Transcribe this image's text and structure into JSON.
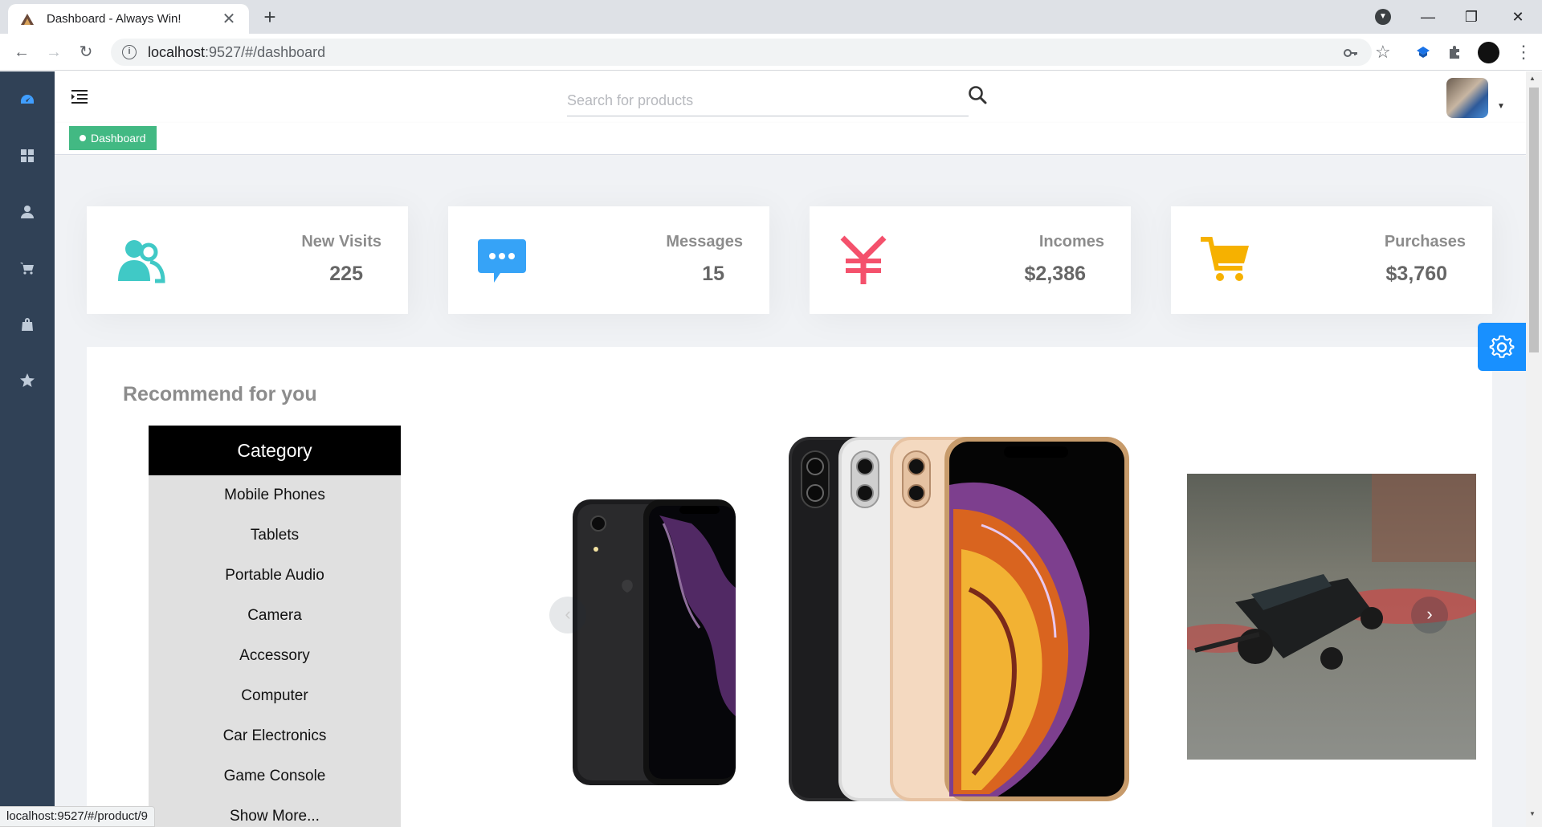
{
  "browser": {
    "tab_title": "Dashboard - Always Win!",
    "url_host": "localhost",
    "url_path": ":9527/#/dashboard",
    "status_url": "localhost:9527/#/product/9"
  },
  "navbar": {
    "search_placeholder": "Search for products"
  },
  "tags": [
    {
      "label": "Dashboard",
      "active": true
    }
  ],
  "sidebar": {
    "items": [
      {
        "icon": "dashboard-icon"
      },
      {
        "icon": "component-icon"
      },
      {
        "icon": "user-icon"
      },
      {
        "icon": "cart-icon"
      },
      {
        "icon": "shopping-bag-icon"
      },
      {
        "icon": "star-icon"
      }
    ]
  },
  "cards": [
    {
      "label": "New Visits",
      "value": "225",
      "icon": "peoples-icon",
      "color": "#40c9c6"
    },
    {
      "label": "Messages",
      "value": "15",
      "icon": "message-icon",
      "color": "#36a3f7"
    },
    {
      "label": "Incomes",
      "value": "$2,386",
      "icon": "money-yen-icon",
      "color": "#f4516c"
    },
    {
      "label": "Purchases",
      "value": "$3,760",
      "icon": "shopping-cart-icon",
      "color": "#f6b100"
    }
  ],
  "recommend": {
    "title": "Recommend for you",
    "category_header": "Category",
    "categories": [
      "Mobile Phones",
      "Tablets",
      "Portable Audio",
      "Camera",
      "Accessory",
      "Computer",
      "Car Electronics",
      "Game Console",
      "Show More..."
    ]
  },
  "colors": {
    "sidebar_bg": "#304156",
    "tag_active": "#42b983",
    "settings_btn": "#1890ff"
  }
}
